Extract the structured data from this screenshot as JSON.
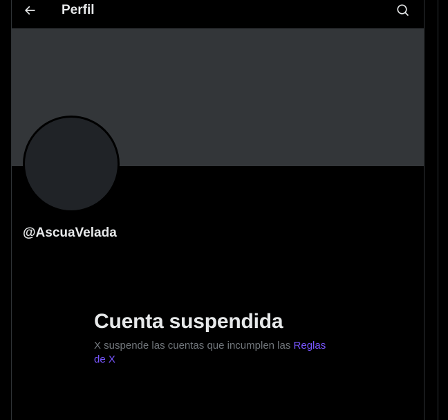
{
  "header": {
    "title": "Perfil",
    "back_icon": "arrow-left-icon",
    "search_icon": "search-icon"
  },
  "profile": {
    "handle": "@AscuaVelada",
    "banner_color": "#333639",
    "avatar_color": "#202327"
  },
  "notice": {
    "title": "Cuenta suspendida",
    "body": "X suspende las cuentas que incumplen las ",
    "link_label": "Reglas de X",
    "link_color": "#7856ff"
  },
  "colors": {
    "background": "#000000",
    "text_primary": "#e7e9ea",
    "text_secondary": "#71767b",
    "border": "#2f3336"
  }
}
